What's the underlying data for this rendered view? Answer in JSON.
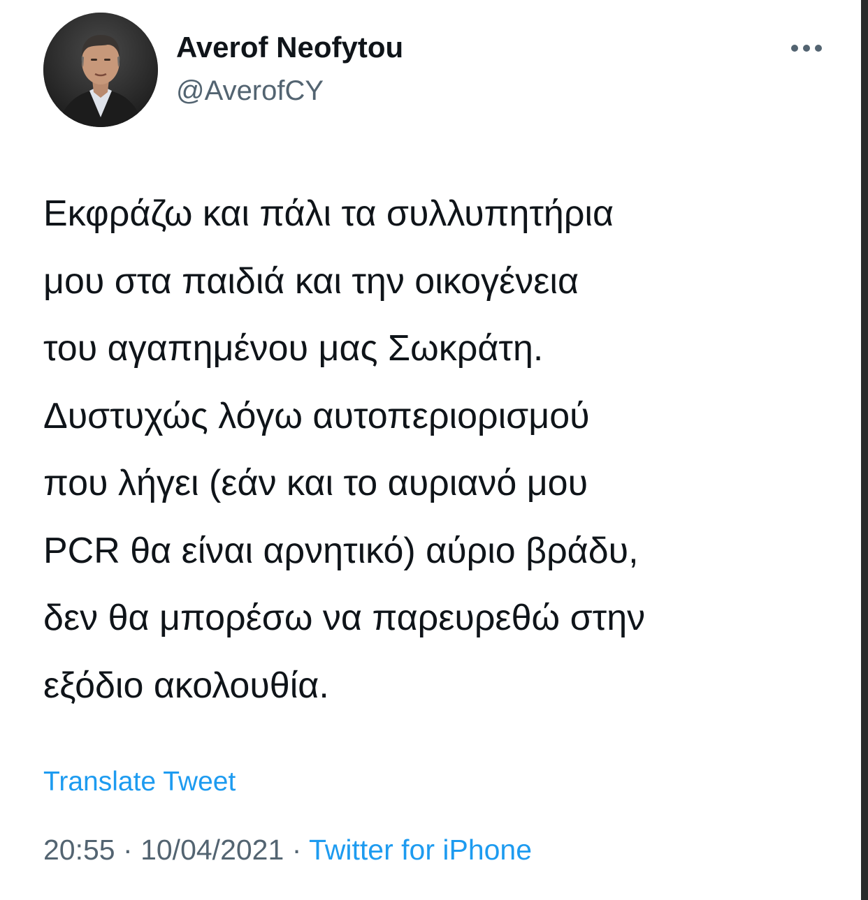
{
  "tweet": {
    "author": {
      "display_name": "Averof Neofytou",
      "handle": "@AverofCY",
      "avatar_icon": "profile-photo"
    },
    "more_icon": "more-horizontal-icon",
    "text_lines": [
      "Εκφράζω και πάλι τα συλλυπητήρια",
      "μου στα παιδιά και την οικογένεια",
      "του αγαπημένου μας Σωκράτη.",
      "Δυστυχώς λόγω αυτοπεριορισμού",
      "που λήγει (εάν και το αυριανό μου",
      "PCR θα είναι αρνητικό) αύριο βράδυ,",
      "δεν θα μπορέσω να παρευρεθώ στην",
      "εξόδιο ακολουθία."
    ],
    "translate_label": "Translate Tweet",
    "time": "20:55",
    "date": "10/04/2021",
    "separator": "·",
    "source": "Twitter for iPhone"
  },
  "colors": {
    "text_primary": "#0f1419",
    "text_secondary": "#536471",
    "link": "#1d9bf0",
    "background": "#ffffff"
  }
}
